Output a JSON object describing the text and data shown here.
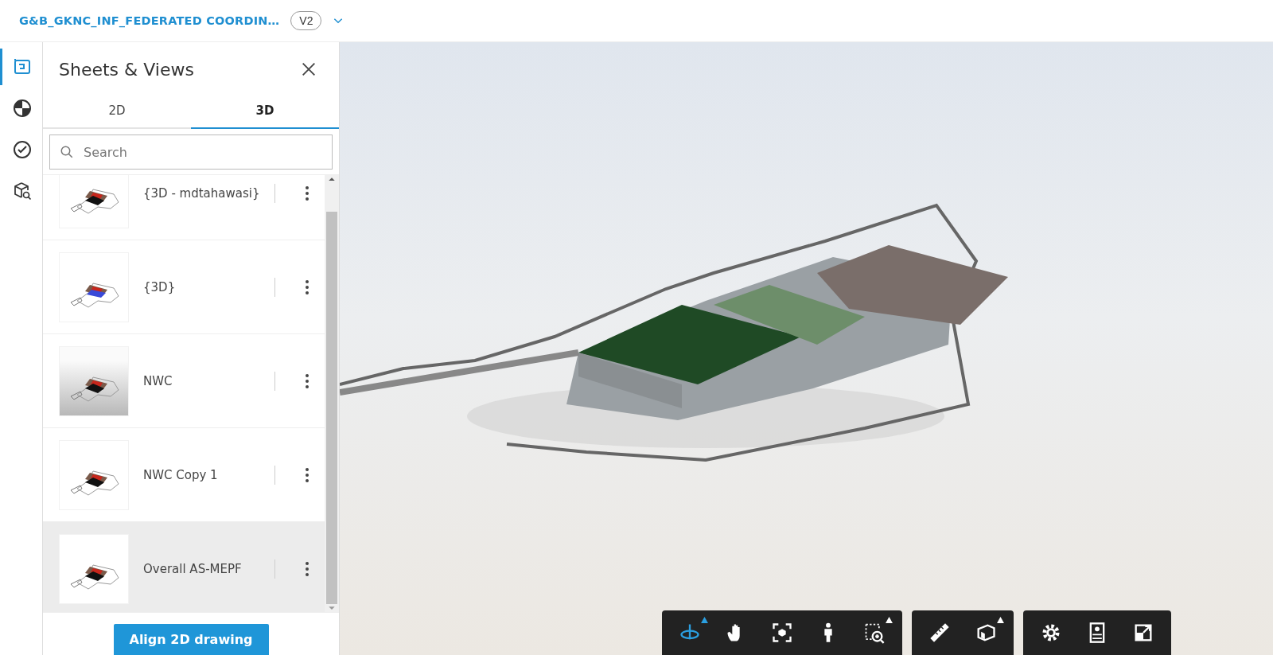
{
  "header": {
    "title": "G&B_GKNC_INF_FEDERATED COORDIN…",
    "version": "V2"
  },
  "rail": [
    {
      "kind": "sheets",
      "selected": true
    },
    {
      "kind": "model",
      "selected": false
    },
    {
      "kind": "check",
      "selected": false
    },
    {
      "kind": "cube-search",
      "selected": false
    }
  ],
  "panel": {
    "title": "Sheets & Views",
    "tabs": [
      {
        "label": "2D",
        "selected": false
      },
      {
        "label": "3D",
        "selected": true
      }
    ],
    "search": {
      "placeholder": "Search"
    },
    "views": [
      {
        "name": "{3D - mdtahawasi}",
        "kind": "plain",
        "selected": false
      },
      {
        "name": "{3D}",
        "kind": "blue",
        "selected": false
      },
      {
        "name": "NWC",
        "kind": "grey",
        "selected": false
      },
      {
        "name": "NWC Copy 1",
        "kind": "plain",
        "selected": false
      },
      {
        "name": "Overall AS-MEPF",
        "kind": "plain",
        "selected": true
      }
    ],
    "button": "Align 2D drawing"
  },
  "toolbar": [
    [
      {
        "kind": "orbit",
        "active": true,
        "flyout": true
      },
      {
        "kind": "pan",
        "active": false,
        "flyout": false
      },
      {
        "kind": "fit",
        "active": false,
        "flyout": false
      },
      {
        "kind": "walk",
        "active": false,
        "flyout": false
      },
      {
        "kind": "zoom",
        "active": false,
        "flyout": true
      }
    ],
    [
      {
        "kind": "measure",
        "active": false,
        "flyout": false
      },
      {
        "kind": "section",
        "active": false,
        "flyout": true
      }
    ],
    [
      {
        "kind": "settings",
        "active": false,
        "flyout": false
      },
      {
        "kind": "properties",
        "active": false,
        "flyout": false
      },
      {
        "kind": "fullscreen",
        "active": false,
        "flyout": false
      }
    ]
  ]
}
